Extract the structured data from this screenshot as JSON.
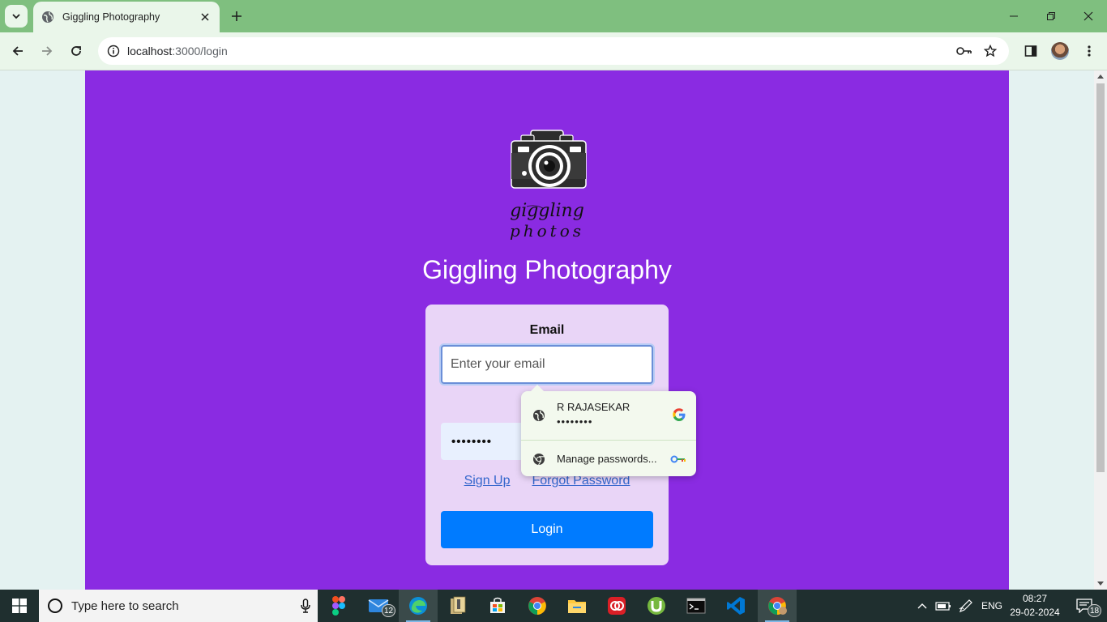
{
  "browser": {
    "tab_title": "Giggling Photography",
    "url_host": "localhost",
    "url_path": ":3000/login"
  },
  "page": {
    "logo_text_line1": "giggling",
    "logo_text_line2": "photos",
    "brand_title": "Giggling Photography",
    "email_label": "Email",
    "email_placeholder": "Enter your email",
    "password_label_partial": "P",
    "password_value": "••••••••",
    "signup_link": "Sign Up",
    "forgot_link": "Forgot Password",
    "login_button": "Login",
    "bg_color": "#8a2be2",
    "button_color": "#007bff"
  },
  "password_popup": {
    "username": "R RAJASEKAR",
    "password_mask": "••••••••",
    "manage_label": "Manage passwords..."
  },
  "taskbar": {
    "search_placeholder": "Type here to search",
    "mail_badge": "12",
    "language": "ENG",
    "time": "08:27",
    "date": "29-02-2024",
    "notification_count": "18"
  }
}
